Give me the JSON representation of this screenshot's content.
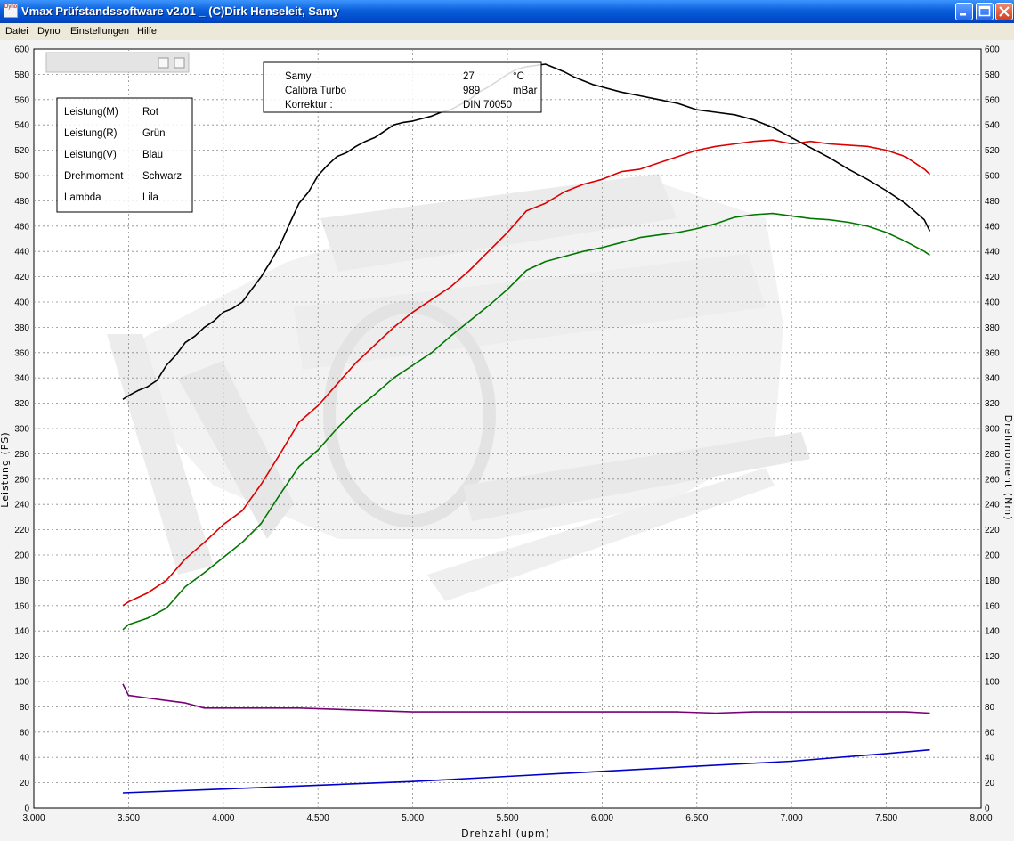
{
  "window": {
    "title": "Vmax Prüfstandssoftware v2.01 _ (C)Dirk Henseleit, Samy",
    "icon_text": "Dyno"
  },
  "menu": [
    "Datei",
    "Dyno",
    "Einstellungen",
    "Hilfe"
  ],
  "legend": [
    {
      "label": "Leistung(M)",
      "color_name": "Rot",
      "color": "#dd0000"
    },
    {
      "label": "Leistung(R)",
      "color_name": "Grün",
      "color": "#007700"
    },
    {
      "label": "Leistung(V)",
      "color_name": "Blau",
      "color": "#0000cc"
    },
    {
      "label": "Drehmoment",
      "color_name": "Schwarz",
      "color": "#000000"
    },
    {
      "label": "Lambda",
      "color_name": "Lila",
      "color": "#770077"
    }
  ],
  "info": [
    {
      "label": "Samy",
      "value": "27",
      "unit": "°C"
    },
    {
      "label": "Calibra Turbo",
      "value": "989",
      "unit": "mBar"
    },
    {
      "label": "Korrektur :",
      "value": "DIN 70050",
      "unit": ""
    }
  ],
  "chart_data": {
    "type": "line",
    "xlabel": "Drehzahl (upm)",
    "ylabel_left": "Leistung (PS)",
    "ylabel_right": "Drehmoment (Nm)",
    "xlim": [
      3000,
      8000
    ],
    "ylim": [
      0,
      600
    ],
    "xticks": [
      "3.000",
      "3.500",
      "4.000",
      "4.500",
      "5.000",
      "5.500",
      "6.000",
      "6.500",
      "7.000",
      "7.500",
      "8.000"
    ],
    "grid": true,
    "series": [
      {
        "name": "Leistung(M)",
        "color": "#dd0000",
        "x": [
          3470,
          3500,
          3600,
          3700,
          3800,
          3900,
          4000,
          4100,
          4200,
          4300,
          4400,
          4500,
          4600,
          4700,
          4800,
          4900,
          5000,
          5100,
          5200,
          5300,
          5400,
          5500,
          5600,
          5700,
          5800,
          5900,
          6000,
          6100,
          6200,
          6300,
          6400,
          6500,
          6600,
          6700,
          6800,
          6900,
          7000,
          7100,
          7200,
          7300,
          7400,
          7500,
          7600,
          7700,
          7730
        ],
        "y": [
          160,
          163,
          170,
          180,
          197,
          210,
          224,
          235,
          256,
          280,
          305,
          318,
          335,
          352,
          366,
          380,
          392,
          402,
          412,
          425,
          440,
          455,
          472,
          478,
          487,
          493,
          497,
          503,
          505,
          510,
          515,
          520,
          523,
          525,
          527,
          528,
          525,
          527,
          525,
          524,
          523,
          520,
          515,
          505,
          501
        ]
      },
      {
        "name": "Leistung(R)",
        "color": "#007700",
        "x": [
          3470,
          3500,
          3600,
          3700,
          3800,
          3900,
          4000,
          4100,
          4200,
          4300,
          4400,
          4500,
          4600,
          4700,
          4800,
          4900,
          5000,
          5100,
          5200,
          5300,
          5400,
          5500,
          5600,
          5700,
          5800,
          5900,
          6000,
          6100,
          6200,
          6300,
          6400,
          6500,
          6600,
          6700,
          6800,
          6900,
          7000,
          7100,
          7200,
          7300,
          7400,
          7500,
          7600,
          7700,
          7730
        ],
        "y": [
          141,
          145,
          150,
          158,
          175,
          186,
          198,
          210,
          225,
          248,
          270,
          283,
          300,
          315,
          327,
          340,
          350,
          360,
          373,
          385,
          397,
          410,
          425,
          432,
          436,
          440,
          443,
          447,
          451,
          453,
          455,
          458,
          462,
          467,
          469,
          470,
          468,
          466,
          465,
          463,
          460,
          455,
          448,
          440,
          437
        ]
      },
      {
        "name": "Leistung(V)",
        "color": "#0000cc",
        "x": [
          3470,
          4000,
          4500,
          5000,
          5500,
          6000,
          6500,
          7000,
          7500,
          7730
        ],
        "y": [
          12,
          15,
          18,
          21,
          25,
          29,
          33,
          37,
          43,
          46
        ]
      },
      {
        "name": "Drehmoment",
        "color": "#000000",
        "x": [
          3470,
          3500,
          3550,
          3600,
          3650,
          3700,
          3750,
          3800,
          3850,
          3900,
          3950,
          4000,
          4050,
          4100,
          4150,
          4200,
          4250,
          4300,
          4350,
          4400,
          4450,
          4500,
          4550,
          4600,
          4650,
          4700,
          4750,
          4800,
          4850,
          4900,
          4950,
          5000,
          5050,
          5100,
          5150,
          5200,
          5250,
          5300,
          5350,
          5400,
          5450,
          5500,
          5550,
          5600,
          5650,
          5700,
          5750,
          5800,
          5850,
          5900,
          5950,
          6000,
          6100,
          6200,
          6300,
          6400,
          6500,
          6600,
          6700,
          6800,
          6900,
          7000,
          7100,
          7200,
          7300,
          7400,
          7500,
          7600,
          7700,
          7730
        ],
        "y": [
          323,
          326,
          330,
          333,
          338,
          350,
          358,
          368,
          373,
          380,
          385,
          392,
          395,
          400,
          410,
          420,
          432,
          445,
          462,
          478,
          487,
          500,
          508,
          515,
          518,
          523,
          527,
          530,
          535,
          540,
          542,
          543,
          545,
          547,
          550,
          552,
          556,
          560,
          566,
          570,
          575,
          580,
          584,
          586,
          587,
          588,
          585,
          582,
          578,
          575,
          572,
          570,
          566,
          563,
          560,
          557,
          552,
          550,
          548,
          544,
          538,
          530,
          522,
          514,
          505,
          497,
          488,
          478,
          465,
          456
        ]
      },
      {
        "name": "Lambda",
        "color": "#770077",
        "x": [
          3470,
          3500,
          3550,
          3600,
          3700,
          3800,
          3900,
          4000,
          4200,
          4400,
          4600,
          4800,
          5000,
          5200,
          5400,
          5600,
          5800,
          6000,
          6200,
          6400,
          6600,
          6800,
          7000,
          7200,
          7400,
          7600,
          7730
        ],
        "y": [
          98,
          89,
          88,
          87,
          85,
          83,
          79,
          79,
          79,
          79,
          78,
          77,
          76,
          76,
          76,
          76,
          76,
          76,
          76,
          76,
          75,
          76,
          76,
          76,
          76,
          76,
          75
        ]
      }
    ]
  }
}
